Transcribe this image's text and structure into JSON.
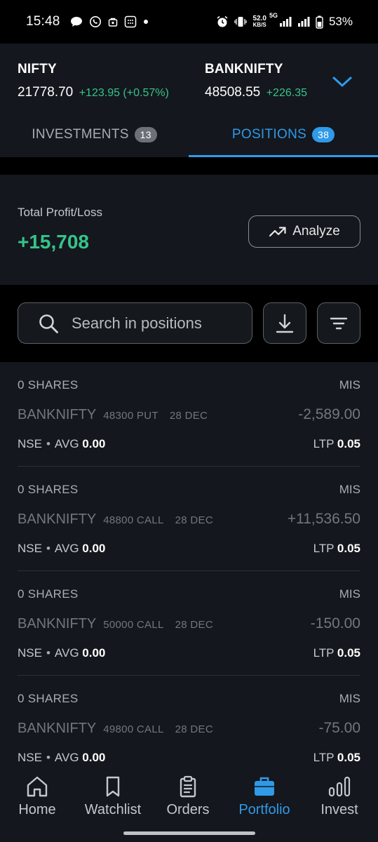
{
  "status_bar": {
    "time": "15:48",
    "speed_value": "52.0",
    "speed_unit": "KB/S",
    "network": "5G",
    "battery": "53%"
  },
  "indices": [
    {
      "name": "NIFTY",
      "value": "21778.70",
      "change": "+123.95 (+0.57%)"
    },
    {
      "name": "BANKNIFTY",
      "value": "48508.55",
      "change": "+226.35"
    }
  ],
  "tabs": [
    {
      "label": "INVESTMENTS",
      "count": "13",
      "active": false
    },
    {
      "label": "POSITIONS",
      "count": "38",
      "active": true
    }
  ],
  "summary": {
    "label": "Total Profit/Loss",
    "value": "+15,708",
    "value_color": "#35c48a",
    "analyze_label": "Analyze"
  },
  "search": {
    "placeholder": "Search in positions"
  },
  "positions": [
    {
      "shares": "0 SHARES",
      "product": "MIS",
      "symbol": "BANKNIFTY",
      "strike": "48300 PUT",
      "expiry": "28 DEC",
      "pnl": "-2,589.00",
      "exchange": "NSE",
      "avg_label": "AVG",
      "avg": "0.00",
      "ltp_label": "LTP",
      "ltp": "0.05"
    },
    {
      "shares": "0 SHARES",
      "product": "MIS",
      "symbol": "BANKNIFTY",
      "strike": "48800 CALL",
      "expiry": "28 DEC",
      "pnl": "+11,536.50",
      "exchange": "NSE",
      "avg_label": "AVG",
      "avg": "0.00",
      "ltp_label": "LTP",
      "ltp": "0.05"
    },
    {
      "shares": "0 SHARES",
      "product": "MIS",
      "symbol": "BANKNIFTY",
      "strike": "50000 CALL",
      "expiry": "28 DEC",
      "pnl": "-150.00",
      "exchange": "NSE",
      "avg_label": "AVG",
      "avg": "0.00",
      "ltp_label": "LTP",
      "ltp": "0.05"
    },
    {
      "shares": "0 SHARES",
      "product": "MIS",
      "symbol": "BANKNIFTY",
      "strike": "49800 CALL",
      "expiry": "28 DEC",
      "pnl": "-75.00",
      "exchange": "NSE",
      "avg_label": "AVG",
      "avg": "0.00",
      "ltp_label": "LTP",
      "ltp": "0.05"
    }
  ],
  "nav": [
    {
      "label": "Home",
      "icon": "home-icon"
    },
    {
      "label": "Watchlist",
      "icon": "bookmark-icon"
    },
    {
      "label": "Orders",
      "icon": "clipboard-icon"
    },
    {
      "label": "Portfolio",
      "icon": "briefcase-icon",
      "active": true
    },
    {
      "label": "Invest",
      "icon": "bar-chart-icon"
    }
  ],
  "colors": {
    "accent": "#2f9ae8",
    "positive": "#35c48a",
    "background": "#14171d"
  }
}
